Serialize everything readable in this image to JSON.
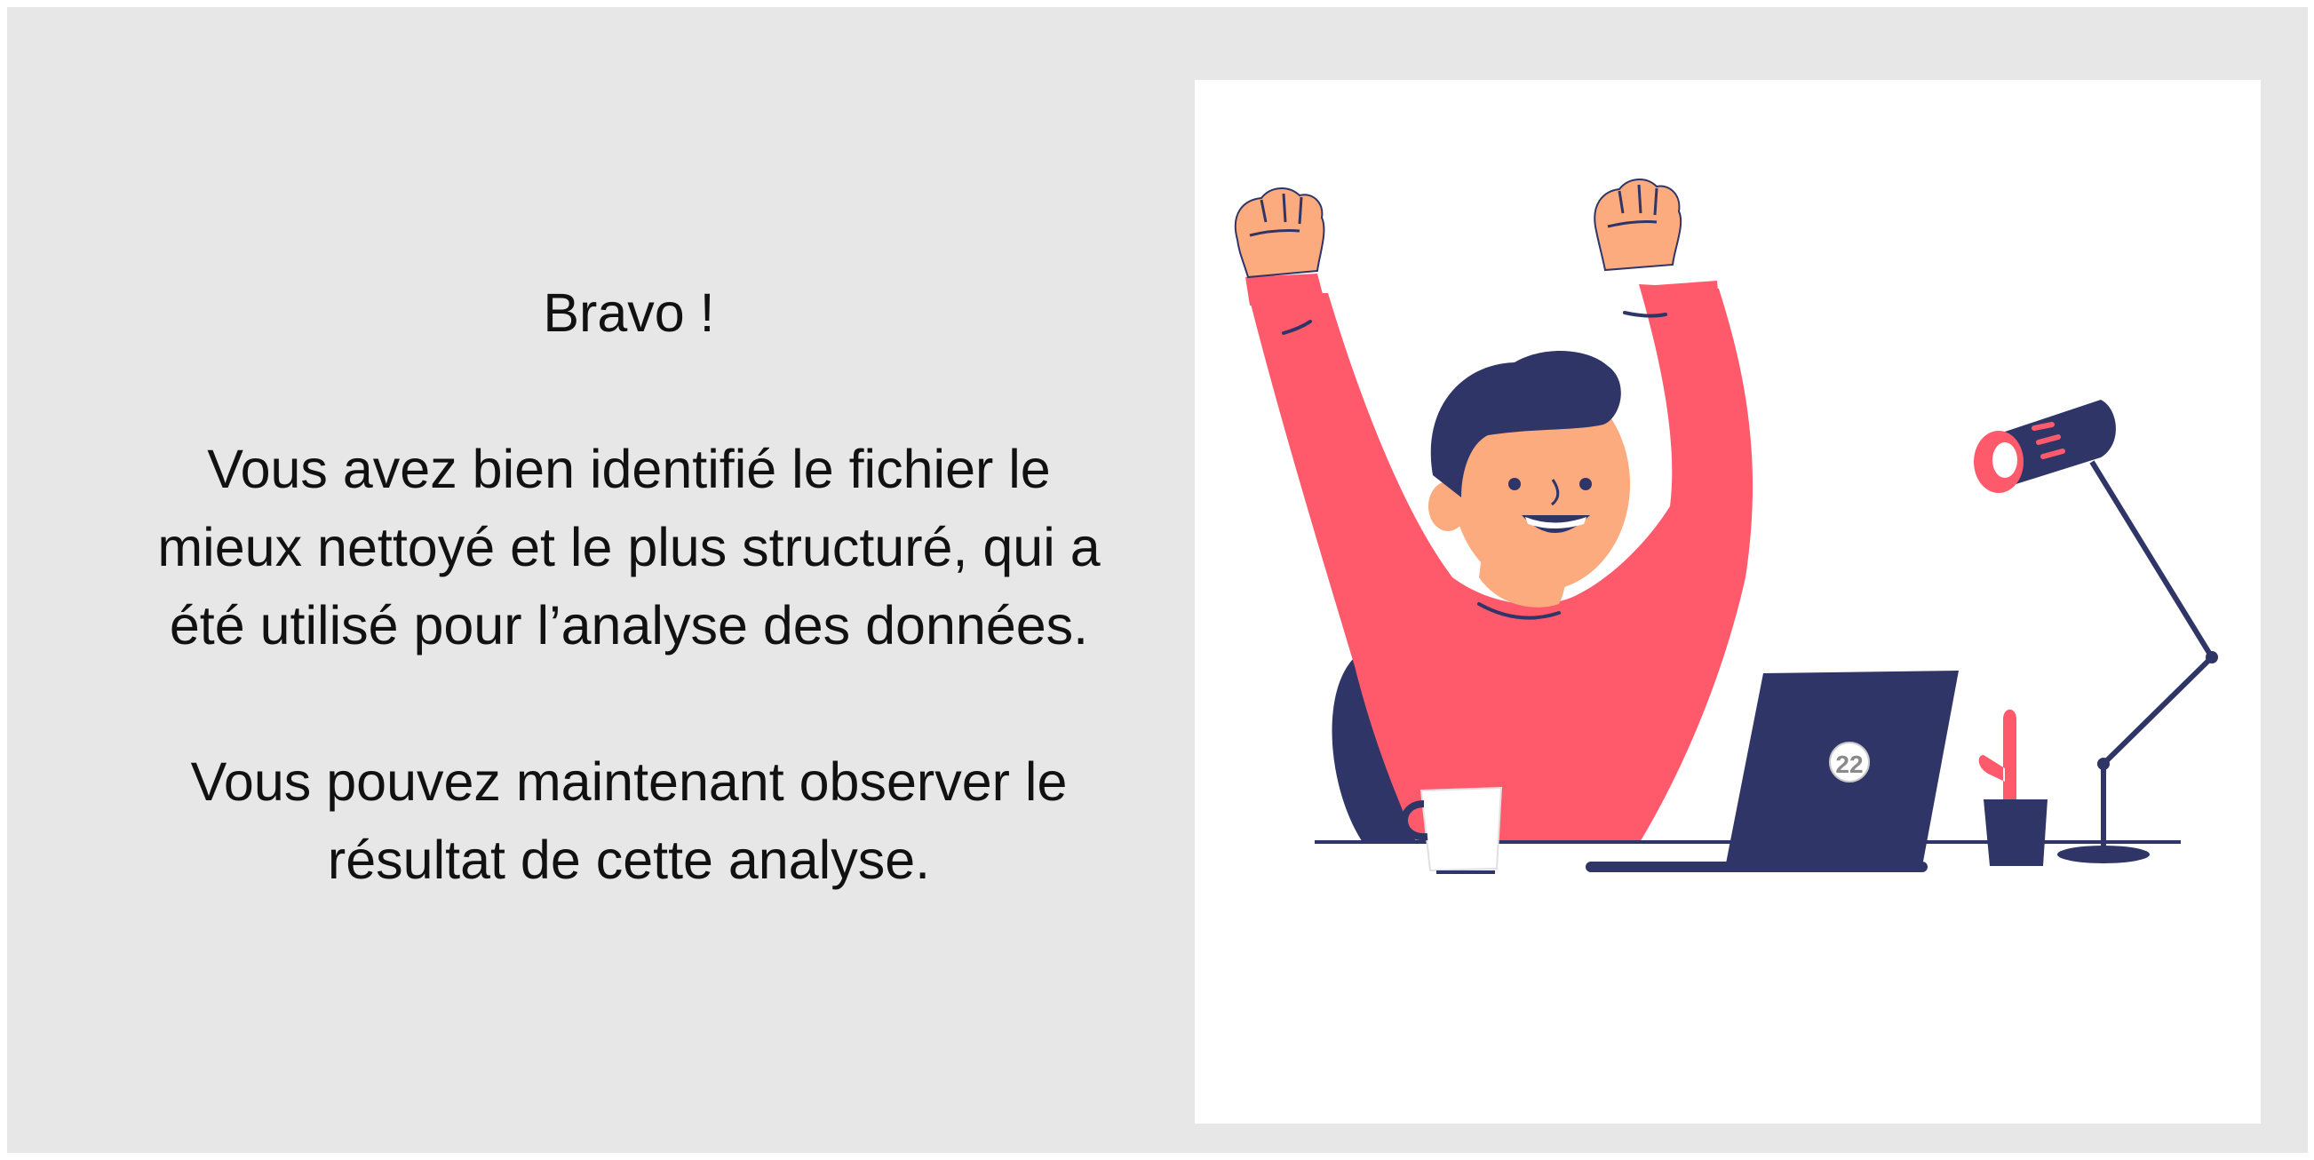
{
  "message": {
    "title": "Bravo !",
    "line1": "Vous avez bien identifié le fichier le",
    "line2": "mieux nettoyé et le plus structuré, qui a",
    "line3": "été utilisé pour l’analyse des données.",
    "line4": "Vous pouvez maintenant observer le",
    "line5": "résultat de cette analyse."
  },
  "illustration": {
    "laptop_sticker": "22",
    "colors": {
      "sweater": "#fe5a6b",
      "navy": "#2f3566",
      "skin": "#fbab7e",
      "background": "#e7e7e7",
      "panel": "#ffffff"
    }
  }
}
